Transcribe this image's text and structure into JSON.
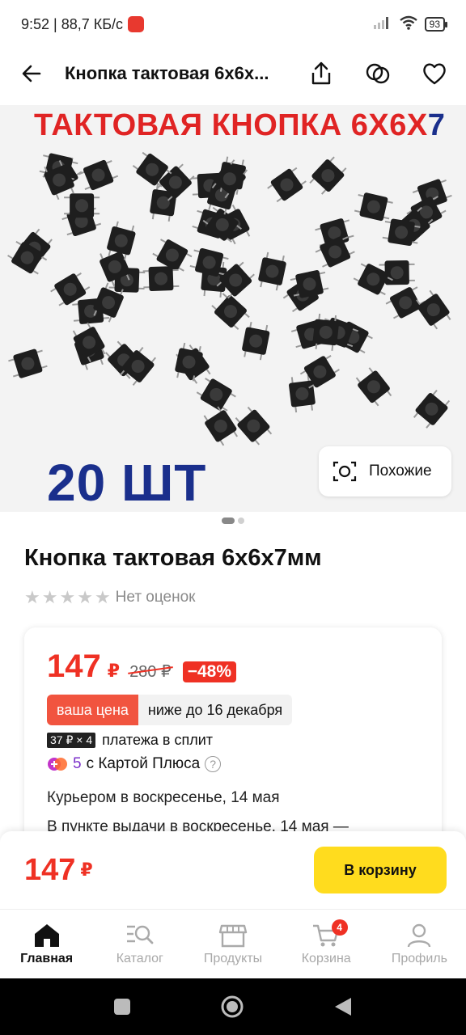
{
  "status_bar": {
    "time_speed": "9:52 | 88,7 КБ/с",
    "battery": "93"
  },
  "header": {
    "title": "Кнопка тактовая 6х6х..."
  },
  "hero": {
    "title_text": "ТАКТОВАЯ КНОПКА 6Х6Х",
    "title_num": "7",
    "quantity": "20 ШТ",
    "similar_label": "Похожие"
  },
  "product": {
    "title": "Кнопка тактовая 6х6х7мм",
    "rating_text": "Нет оценок",
    "price": "147",
    "currency": "₽",
    "old_price": "280 ₽",
    "discount": "−48%",
    "your_price_label": "ваша цена",
    "your_price_note": "ниже до 16 декабря",
    "split_badge": "37 ₽ × 4",
    "split_text": "платежа в сплит",
    "plus_points": "5",
    "plus_text": "с Картой Плюса",
    "help": "?",
    "delivery_courier": "Курьером в воскресенье, 14 мая",
    "delivery_pickup": "В пункте выдачи в воскресенье, 14 мая —"
  },
  "buy_bar": {
    "price": "147",
    "currency": "₽",
    "cart_button": "В корзину"
  },
  "bottom_nav": {
    "items": [
      {
        "label": "Главная"
      },
      {
        "label": "Каталог"
      },
      {
        "label": "Продукты"
      },
      {
        "label": "Корзина",
        "badge": "4"
      },
      {
        "label": "Профиль"
      }
    ]
  },
  "colors": {
    "accent_red": "#ef3124",
    "cart_yellow": "#ffdc1e",
    "hero_blue": "#1a2f8c"
  }
}
